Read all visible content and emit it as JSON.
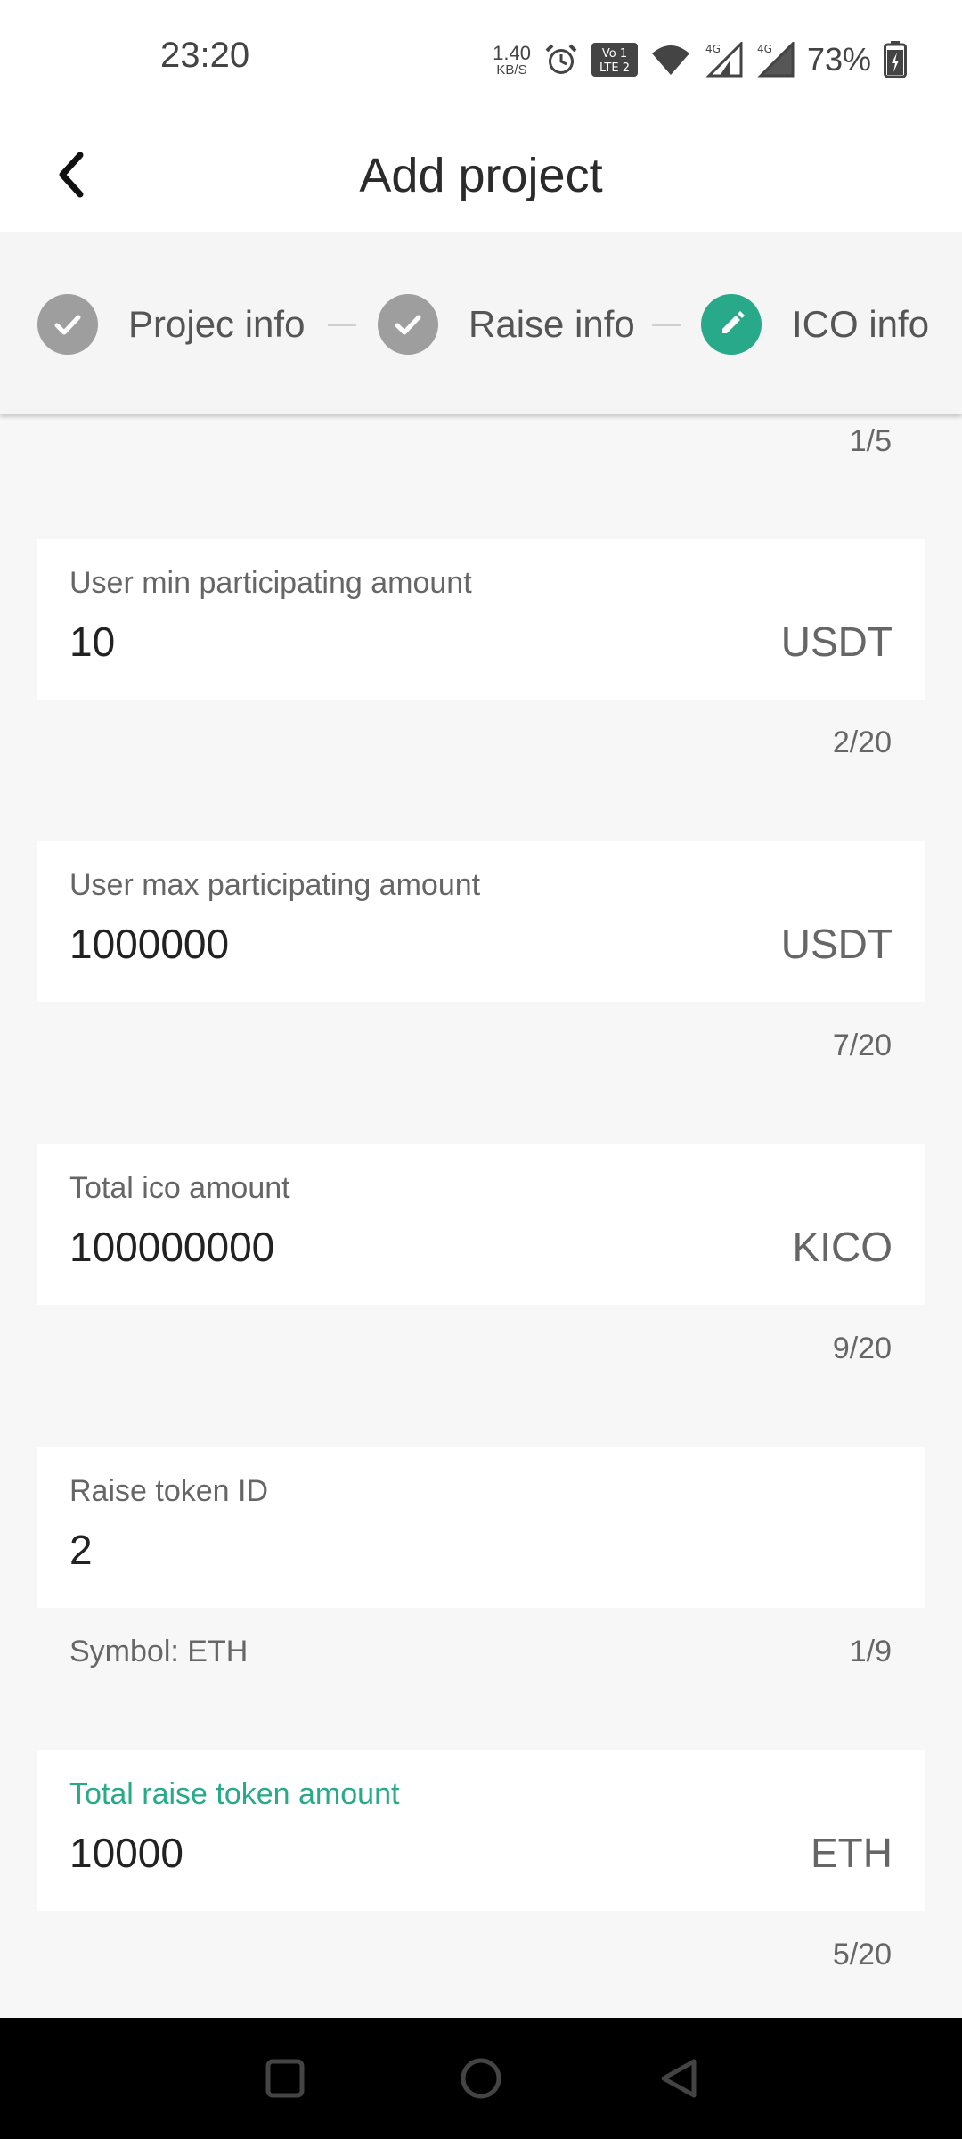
{
  "status_bar": {
    "time": "23:20",
    "net_speed_value": "1.40",
    "net_speed_unit": "KB/S",
    "battery_percent": "73%",
    "icons": [
      "alarm-icon",
      "volte-icon",
      "wifi-icon",
      "signal-4g-icon",
      "signal-4g-icon",
      "battery-icon"
    ]
  },
  "header": {
    "title": "Add project",
    "back_icon": "chevron-left-icon"
  },
  "stepper": {
    "steps": [
      {
        "label": "Projec info",
        "state": "done",
        "icon": "check-icon"
      },
      {
        "label": "Raise info",
        "state": "done",
        "icon": "check-icon"
      },
      {
        "label": "ICO info",
        "state": "active",
        "icon": "pencil-icon"
      }
    ],
    "colors": {
      "done": "#9e9e9e",
      "active": "#27a98a"
    }
  },
  "form": {
    "top_counter": "1/5",
    "fields": [
      {
        "label": "User min participating amount",
        "value": "10",
        "unit": "USDT",
        "counter": "2/20",
        "helper": ""
      },
      {
        "label": "User max participating amount",
        "value": "1000000",
        "unit": "USDT",
        "counter": "7/20",
        "helper": ""
      },
      {
        "label": "Total ico amount",
        "value": "100000000",
        "unit": "KICO",
        "counter": "9/20",
        "helper": ""
      },
      {
        "label": "Raise token ID",
        "value": "2",
        "unit": "",
        "counter": "1/9",
        "helper": "Symbol: ETH"
      },
      {
        "label": "Total raise token amount",
        "value": "10000",
        "unit": "ETH",
        "counter": "5/20",
        "helper": "",
        "focused": true
      }
    ],
    "accent_color": "#27a98a"
  },
  "nav_bar": {
    "buttons": [
      "recent-apps-icon",
      "home-icon",
      "back-icon"
    ]
  }
}
